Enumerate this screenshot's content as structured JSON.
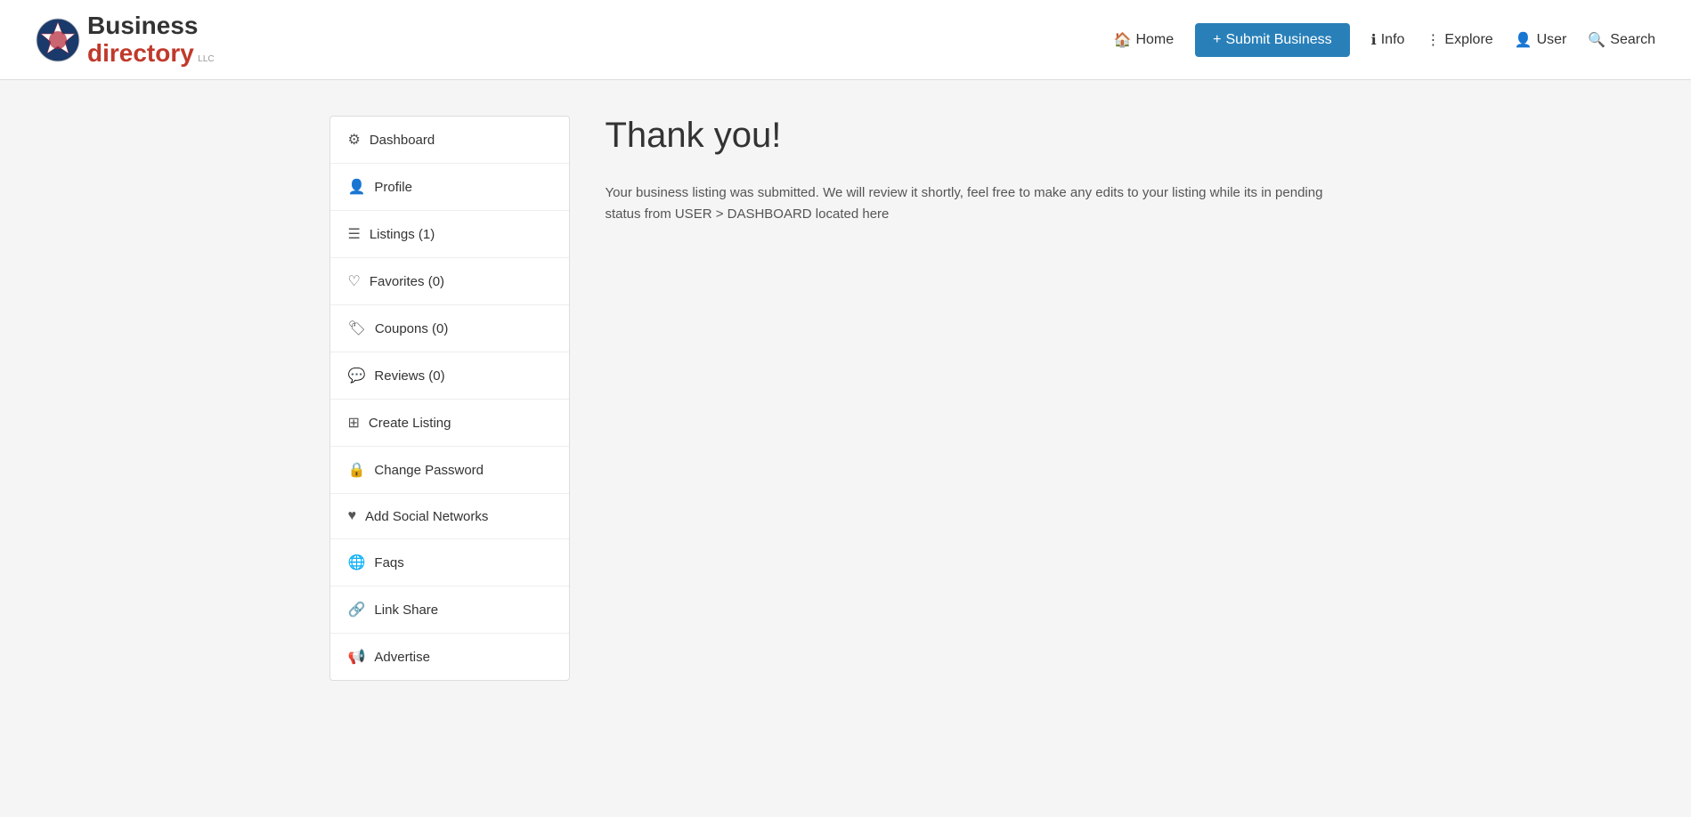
{
  "header": {
    "logo": {
      "business": "Business",
      "directory": "directory",
      "llc": "LLC"
    },
    "nav": {
      "home": "Home",
      "submit": "+ Submit Business",
      "info": "Info",
      "explore": "Explore",
      "user": "User",
      "search": "Search"
    }
  },
  "sidebar": {
    "items": [
      {
        "id": "dashboard",
        "label": "Dashboard",
        "icon": "🎮"
      },
      {
        "id": "profile",
        "label": "Profile",
        "icon": "👤"
      },
      {
        "id": "listings",
        "label": "Listings (1)",
        "icon": "≡"
      },
      {
        "id": "favorites",
        "label": "Favorites (0)",
        "icon": "♡"
      },
      {
        "id": "coupons",
        "label": "Coupons (0)",
        "icon": "🏷"
      },
      {
        "id": "reviews",
        "label": "Reviews (0)",
        "icon": "💬"
      },
      {
        "id": "create-listing",
        "label": "Create Listing",
        "icon": "⊞"
      },
      {
        "id": "change-password",
        "label": "Change Password",
        "icon": "🔒"
      },
      {
        "id": "add-social-networks",
        "label": "Add Social Networks",
        "icon": "♥"
      },
      {
        "id": "faqs",
        "label": "Faqs",
        "icon": "🌐"
      },
      {
        "id": "link-share",
        "label": "Link Share",
        "icon": "🔗"
      },
      {
        "id": "advertise",
        "label": "Advertise",
        "icon": "📢"
      }
    ]
  },
  "content": {
    "title": "Thank you!",
    "body": "Your business listing was submitted. We will review it shortly, feel free to make any edits to your listing while its in pending status from USER > DASHBOARD located here"
  }
}
